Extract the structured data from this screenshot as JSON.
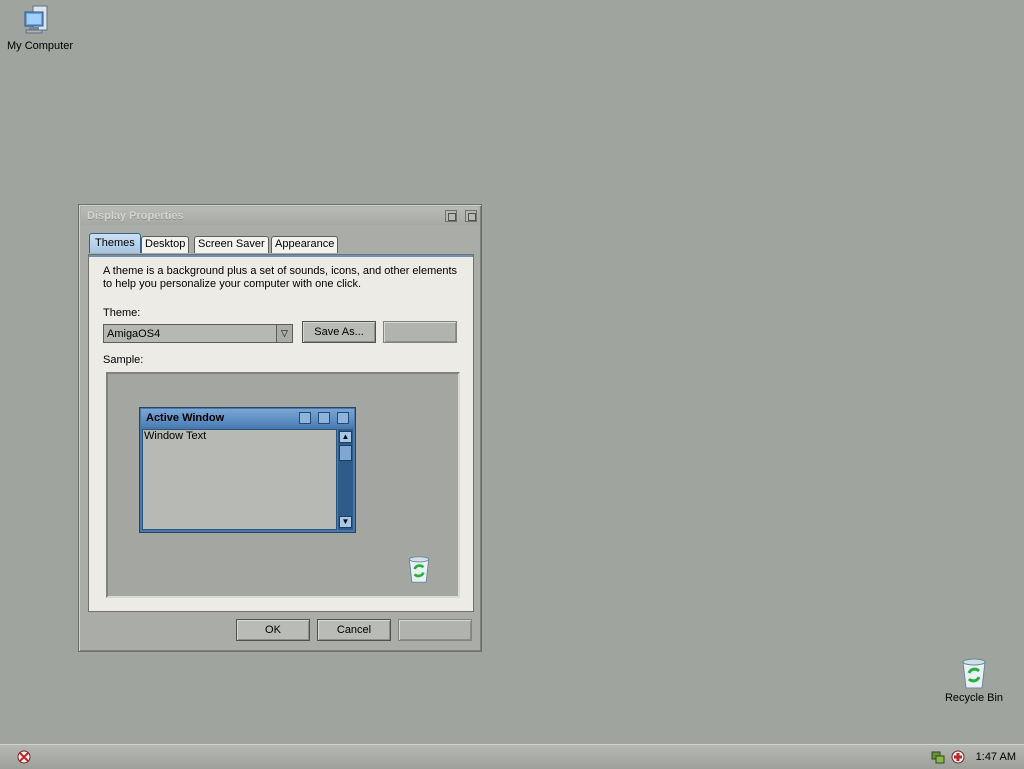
{
  "desktop": {
    "icons": [
      {
        "label": "My Computer",
        "icon": "my-computer-icon"
      },
      {
        "label": "Recycle Bin",
        "icon": "recycle-bin-icon"
      }
    ]
  },
  "dialog": {
    "title": "Display Properties",
    "tabs": [
      {
        "label": "Themes",
        "active": true
      },
      {
        "label": "Desktop",
        "active": false
      },
      {
        "label": "Screen Saver",
        "active": false
      },
      {
        "label": "Appearance",
        "active": false
      }
    ],
    "description": "A theme is a background plus a set of sounds, icons, and other elements to help you personalize your computer with one click.",
    "theme_label": "Theme:",
    "theme_value": "AmigaOS4",
    "save_as_label": "Save As...",
    "sample_label": "Sample:",
    "sample_window": {
      "title": "Active Window",
      "text": "Window Text"
    },
    "buttons": {
      "ok": "OK",
      "cancel": "Cancel"
    }
  },
  "taskbar": {
    "clock": "1:47 AM"
  },
  "colors": {
    "desktop": "#a0a49f",
    "accent_blue": "#4d78a6"
  }
}
